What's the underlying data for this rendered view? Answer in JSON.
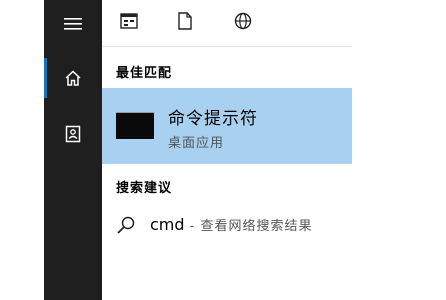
{
  "rail": {
    "items": [
      {
        "icon": "hamburger-icon"
      },
      {
        "icon": "home-icon"
      },
      {
        "icon": "documents-icon"
      }
    ],
    "selected_index": 1
  },
  "topbar": {
    "filters": [
      {
        "icon": "apps-icon"
      },
      {
        "icon": "document-icon"
      },
      {
        "icon": "web-icon"
      }
    ]
  },
  "best_match": {
    "heading": "最佳匹配",
    "app_name": "命令提示符",
    "app_type": "桌面应用"
  },
  "search_suggestions": {
    "heading": "搜索建议",
    "query": "cmd",
    "separator": " - ",
    "action": "查看网络搜索结果"
  },
  "colors": {
    "rail_bg": "#1f1f1f",
    "selected_bg": "#a8d0f0",
    "accent": "#0078d7"
  }
}
